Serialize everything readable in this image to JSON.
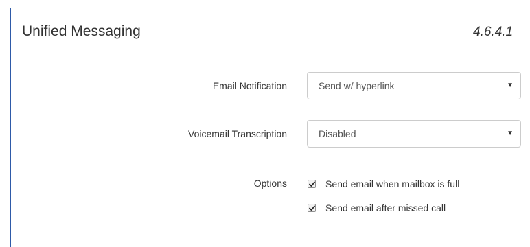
{
  "panel": {
    "title": "Unified Messaging",
    "version": "4.6.4.1"
  },
  "form": {
    "email_notification": {
      "label": "Email Notification",
      "value": "Send w/ hyperlink"
    },
    "voicemail_transcription": {
      "label": "Voicemail Transcription",
      "value": "Disabled"
    },
    "options": {
      "label": "Options",
      "items": [
        {
          "label": "Send email when mailbox is full",
          "checked": true
        },
        {
          "label": "Send email after missed call",
          "checked": true
        }
      ]
    }
  },
  "colors": {
    "frame": "#2e5aa8",
    "border": "#cccccc",
    "text": "#333333"
  },
  "icons": {
    "caret": "caret-down-icon",
    "check": "checkmark-icon"
  }
}
